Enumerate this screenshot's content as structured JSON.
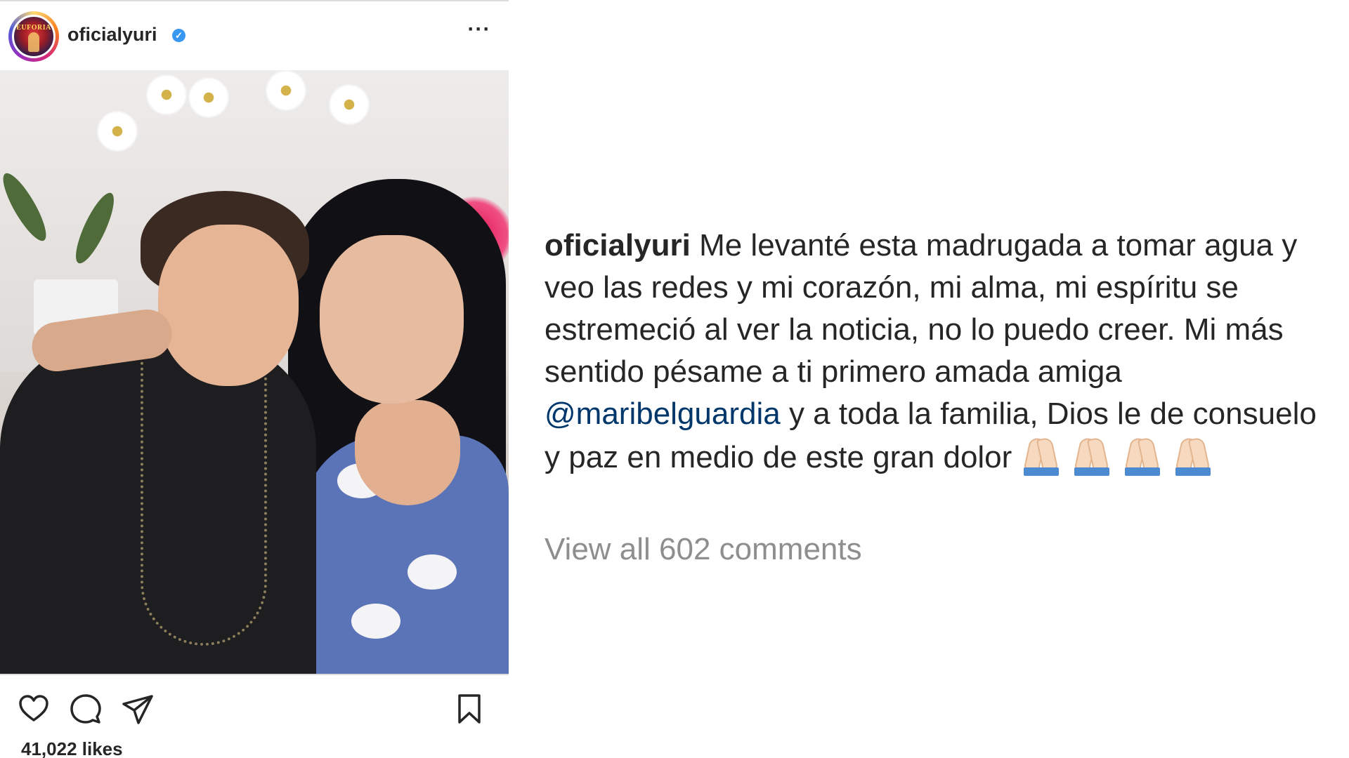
{
  "post": {
    "username": "oficialyuri",
    "verified": true,
    "avatar_logo_text": "EUFORIA",
    "likes_text": "41,022 likes",
    "actions": [
      "heart-icon",
      "comment-icon",
      "share-icon",
      "bookmark-icon"
    ],
    "more_icon": "more-options-icon",
    "photo_icon": "photo"
  },
  "caption": {
    "username": "oficialyuri",
    "text_before_mention": "Me levanté esta madrugada a tomar agua y veo las redes y mi corazón, mi alma, mi espíritu se estremeció al ver la noticia, no lo puedo creer. Mi más sentido pésame a ti primero amada amiga",
    "mention": "@maribelguardia",
    "text_after_mention": "y a toda la familia, Dios le de consuelo y paz en medio de este gran dolor",
    "emoji": "folded-hands-icon",
    "emoji_count": 4
  },
  "comments": {
    "view_all_text": "View all 602 comments"
  },
  "colors": {
    "text": "#262626",
    "secondary": "#8e8e8e",
    "mention": "#00376b",
    "verified": "#3897f0"
  }
}
